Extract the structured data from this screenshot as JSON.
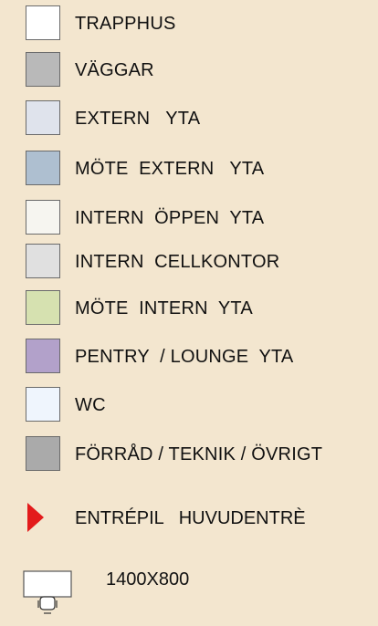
{
  "legend": {
    "items": [
      {
        "label": "TRAPPHUS",
        "color": "#ffffff"
      },
      {
        "label": "VÄGGAR",
        "color": "#b9b9b9"
      },
      {
        "label": "EXTERN   YTA",
        "color": "#dfe3ec"
      },
      {
        "label": "MÖTE  EXTERN   YTA",
        "color": "#aebfd0"
      },
      {
        "label": "INTERN  ÖPPEN  YTA",
        "color": "#f6f5f0"
      },
      {
        "label": "INTERN  CELLKONTOR",
        "color": "#e0e0e0"
      },
      {
        "label": "MÖTE  INTERN  YTA",
        "color": "#d6e1b0"
      },
      {
        "label": "PENTRY  / LOUNGE  YTA",
        "color": "#b2a1ca"
      },
      {
        "label": "WC",
        "color": "#eff5fd"
      },
      {
        "label": "FÖRRÅD / TEKNIK / ÖVRIGT",
        "color": "#aaaaaa"
      }
    ],
    "entrance": {
      "label": "ENTRÉPIL   HUVUDENTRÈ",
      "color": "#e31b1b",
      "icon": "red-triangle-arrow"
    },
    "desk": {
      "label": "1400X800",
      "icon": "desk-with-chair"
    }
  },
  "colors": {
    "background": "#f3e6cf",
    "swatch_border": "#6a6a6a"
  }
}
